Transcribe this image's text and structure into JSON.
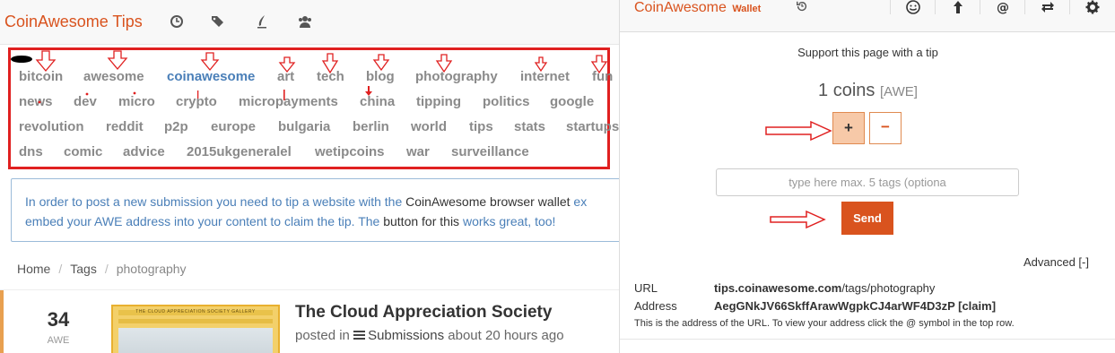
{
  "site": {
    "brand": "CoinAwesome Tips",
    "nav_icons": [
      "history-icon",
      "tags-icon",
      "submit-icon",
      "users-icon"
    ],
    "tags": [
      "bitcoin",
      "awesome",
      "coinawesome",
      "art",
      "tech",
      "blog",
      "photography",
      "internet",
      "fun",
      "news",
      "dev",
      "micro",
      "crypto",
      "micropayments",
      "china",
      "tipping",
      "politics",
      "google",
      "revolution",
      "reddit",
      "p2p",
      "europe",
      "bulgaria",
      "berlin",
      "world",
      "tips",
      "stats",
      "startups",
      "dns",
      "comic",
      "advice",
      "2015ukgeneralel",
      "wetipcoins",
      "war",
      "surveillance"
    ],
    "active_tag": "coinawesome",
    "notice": {
      "p1": "In order to post a new submission you need to tip a website with the ",
      "p2": "CoinAwesome browser wallet",
      "p3": " ex",
      "p4": "embed your AWE address into your content to claim the tip. The ",
      "p5": "button",
      "p6": " ",
      "p7": "for this",
      "p8": " works great, too!"
    },
    "breadcrumb": {
      "home": "Home",
      "tags": "Tags",
      "current": "photography"
    },
    "post": {
      "votes": "34",
      "unit": "AWE",
      "thumb_text": "THE CLOUD APPRECIATION SOCIETY GALLERY",
      "title": "The Cloud Appreciation Society",
      "meta_prefix": "posted in",
      "meta_category": "Submissions",
      "meta_time": "about 20 hours ago"
    }
  },
  "wallet": {
    "brand": "CoinAwesome",
    "brand_sub": "Wallet",
    "support": "Support this page with a tip",
    "coins": "1 coins",
    "coins_unit": "[AWE]",
    "plus": "+",
    "minus": "−",
    "tags_placeholder": "type here max. 5 tags (optiona",
    "send": "Send",
    "advanced": "Advanced [-]",
    "url_label": "URL",
    "url_domain": "tips.coinawesome.com",
    "url_path": "/tags/photography",
    "address_label": "Address",
    "address_value": "AegGNkJV66SkffArawWgpkCJ4arWF4D3zP [claim]",
    "note": "This is the address of the URL. To view your address click the @ symbol in the top row.",
    "header_icons": [
      "smiley-icon",
      "upload-icon",
      "at-icon",
      "transfer-icon",
      "gear-icon"
    ]
  },
  "colors": {
    "accent": "#d9531e",
    "link": "#4a7fb8",
    "annotation": "#e02020"
  }
}
